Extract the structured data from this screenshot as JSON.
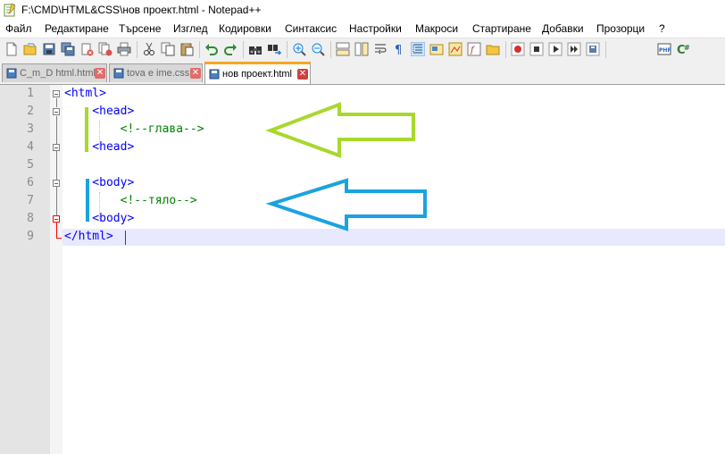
{
  "window": {
    "title": "F:\\CMD\\HTML&CSS\\нов проект.html - Notepad++"
  },
  "menu": [
    "Файл",
    "Редактиране",
    "Търсене",
    "Изглед",
    "Кодировки",
    "Синтаксис",
    "Настройки",
    "Макроси",
    "Стартиране",
    "Добавки",
    "Прозорци",
    "?"
  ],
  "tabs": [
    {
      "label": "C_m_D html.html",
      "active": false
    },
    {
      "label": "tova e ime.css",
      "active": false
    },
    {
      "label": "нов проект.html",
      "active": true
    }
  ],
  "editor": {
    "line_numbers": [
      "1",
      "2",
      "3",
      "4",
      "5",
      "6",
      "7",
      "8",
      "9"
    ],
    "lines": [
      "<html>",
      "    <head>",
      "        <!--глава-->",
      "    <head>",
      "",
      "    <body>",
      "        <!--тяло-->",
      "    <body>",
      "</html>"
    ],
    "current_line": 9
  },
  "annotations": {
    "head_marker_color": "#a8d82c",
    "body_marker_color": "#1aa3e0"
  },
  "icons": [
    "new-file-icon",
    "open-file-icon",
    "save-icon",
    "save-all-icon",
    "close-icon",
    "close-all-icon",
    "print-icon",
    "cut-icon",
    "copy-icon",
    "paste-icon",
    "undo-icon",
    "redo-icon",
    "find-icon",
    "replace-icon",
    "zoom-in-icon",
    "zoom-out-icon",
    "sync-v-icon",
    "sync-h-icon",
    "word-wrap-icon",
    "show-all-icon",
    "indent-guide-icon",
    "udl-icon",
    "doc-map-icon",
    "function-list-icon",
    "folder-workspace-icon",
    "record-macro-icon",
    "stop-record-icon",
    "play-macro-icon",
    "play-multiple-icon",
    "save-macro-icon",
    "php-icon",
    "csharp-icon"
  ]
}
